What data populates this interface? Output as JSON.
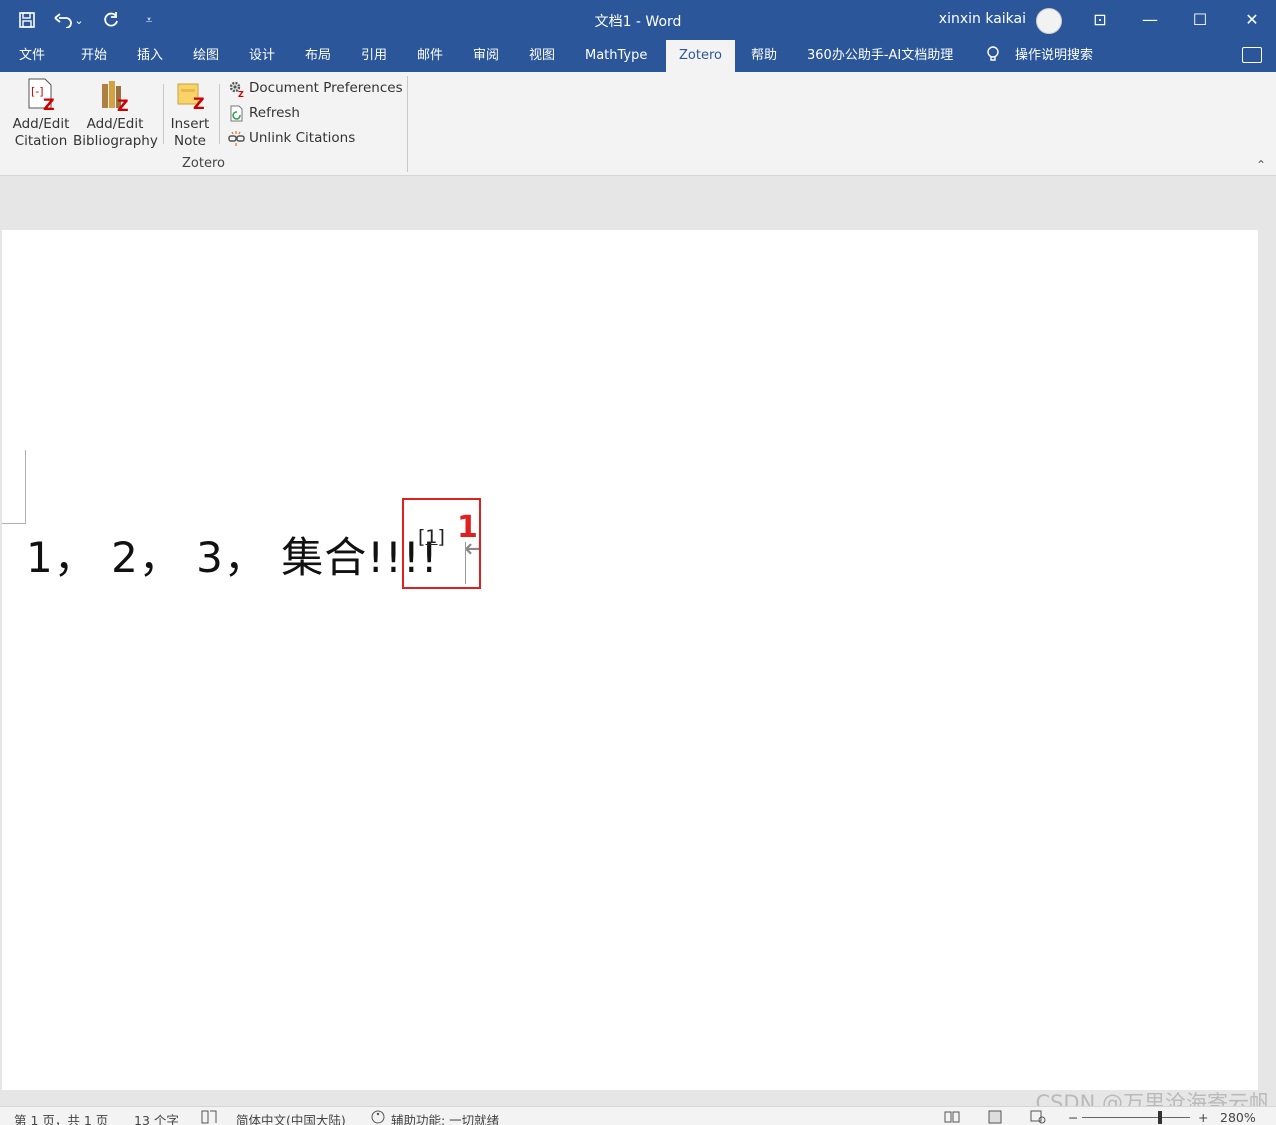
{
  "window": {
    "title": "文档1  -  Word",
    "user_name": "xinxin kaikai",
    "minimize_glyph": "—",
    "maximize_glyph": "☐",
    "close_glyph": "✕",
    "ribbon_display_glyph": "⊡"
  },
  "quick_access": {
    "save_icon": "💾",
    "undo_icon": "↶",
    "undo_dropdown": "⌄",
    "redo_icon": "↻",
    "customize_icon": "⩡"
  },
  "tabs": [
    {
      "label": "文件"
    },
    {
      "label": "开始"
    },
    {
      "label": "插入"
    },
    {
      "label": "绘图"
    },
    {
      "label": "设计"
    },
    {
      "label": "布局"
    },
    {
      "label": "引用"
    },
    {
      "label": "邮件"
    },
    {
      "label": "审阅"
    },
    {
      "label": "视图"
    },
    {
      "label": "MathType"
    },
    {
      "label": "Zotero",
      "active": true
    },
    {
      "label": "帮助"
    },
    {
      "label": "360办公助手-AI文档助理"
    },
    {
      "label": "操作说明搜索"
    }
  ],
  "ribbon": {
    "add_edit_citation": {
      "line1": "Add/Edit",
      "line2": "Citation"
    },
    "add_edit_bibliography": {
      "line1": "Add/Edit",
      "line2": "Bibliography"
    },
    "insert_note": {
      "line1": "Insert",
      "line2": "Note"
    },
    "document_preferences": "Document Preferences",
    "refresh": "Refresh",
    "unlink_citations": "Unlink Citations",
    "group_label": "Zotero",
    "collapse_glyph": "⌃"
  },
  "document": {
    "body_text": "1， 2， 3， 集合!!!!",
    "citation": "[1]",
    "annotation_label": "1",
    "paragraph_mark": "↵"
  },
  "status": {
    "page": "第 1 页，共 1 页",
    "words": "13 个字",
    "language": "简体中文(中国大陆)",
    "accessibility": "辅助功能: 一切就绪",
    "zoom": "280%",
    "zoom_minus": "−",
    "zoom_plus": "+"
  },
  "watermark": "CSDN @万里沧海寄云帆",
  "colors": {
    "title_bar": "#2b579a",
    "annotation_red": "#e02020"
  }
}
